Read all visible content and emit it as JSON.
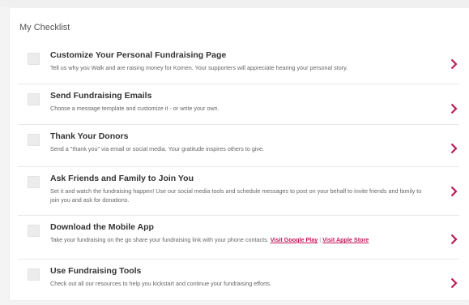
{
  "panel": {
    "title": "My Checklist"
  },
  "accent_color": "#c2185b",
  "items": [
    {
      "title": "Customize Your Personal Fundraising Page",
      "description": "Tell us why you Walk and are raising money for Komen. Your supporters will appreciate hearing your personal story."
    },
    {
      "title": "Send Fundraising Emails",
      "description": "Choose a message template and customize it - or write your own."
    },
    {
      "title": "Thank Your Donors",
      "description": "Send a \"thank you\" via email or social media. Your gratitude inspires others to give."
    },
    {
      "title": "Ask Friends and Family to Join You",
      "description": "Set it and watch the fundraising happen! Use our social media tools and schedule messages to post on your behalf to invite friends and family to join you and ask for donations."
    },
    {
      "title": "Download the Mobile App",
      "description": "Take your fundraising on the go share your fundraising link with your phone contacts.",
      "link_google": "Visit Google Play",
      "link_separator": "|",
      "link_apple": "Visit Apple Store"
    },
    {
      "title": "Use Fundraising Tools",
      "description": "Check out all our resources to help you kickstart and continue your fundraising efforts."
    }
  ]
}
